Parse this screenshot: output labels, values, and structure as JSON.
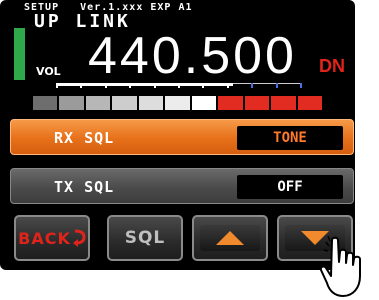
{
  "header": {
    "status_line": "SETUP   Ver.1.xxx EXP A1",
    "mode": "UP LINK",
    "frequency": "440.500",
    "shift": "DN",
    "volume_label": "VOL"
  },
  "meter": {
    "volume_level": 0.72,
    "segments": [
      "#6e6e6e",
      "#9b9b9b",
      "#b7b7b7",
      "#cdcdcd",
      "#dddddd",
      "#ececec",
      "#ffffff",
      "#e22c22",
      "#e22c22",
      "#e22c22",
      "#e22c22"
    ]
  },
  "settings": [
    {
      "label": "RX SQL",
      "value": "TONE",
      "selected": true
    },
    {
      "label": "TX SQL",
      "value": "OFF",
      "selected": false
    }
  ],
  "buttons": {
    "back": "BACK",
    "sql": "SQL",
    "up_icon": "arrow-up-icon",
    "down_icon": "arrow-down-icon"
  },
  "colors": {
    "accent_orange": "#ef7f2c",
    "shift_red": "#e0241b",
    "signal_green": "#2ea84a",
    "arrow_orange": "#f08a2c"
  }
}
